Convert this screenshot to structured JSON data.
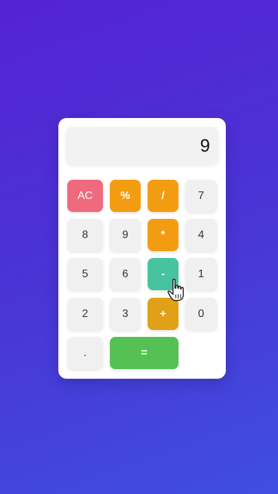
{
  "display": {
    "value": "9"
  },
  "keys": {
    "ac": "AC",
    "percent": "%",
    "divide": "/",
    "seven": "7",
    "eight": "8",
    "nine": "9",
    "multiply": "*",
    "four": "4",
    "five": "5",
    "six": "6",
    "minus": "-",
    "one": "1",
    "two": "2",
    "three": "3",
    "plus": "+",
    "zero": "0",
    "dot": ".",
    "equals": "="
  },
  "colors": {
    "background_top": "#5423d3",
    "background_bottom": "#3f4ee0",
    "ac": "#ee6a7c",
    "operator": "#f39c12",
    "minus_hover": "#47c3a0",
    "plus": "#e0a018",
    "equals": "#55c155",
    "number": "#f0f0f0"
  },
  "cursor": {
    "icon": "hand-pointer-icon"
  }
}
